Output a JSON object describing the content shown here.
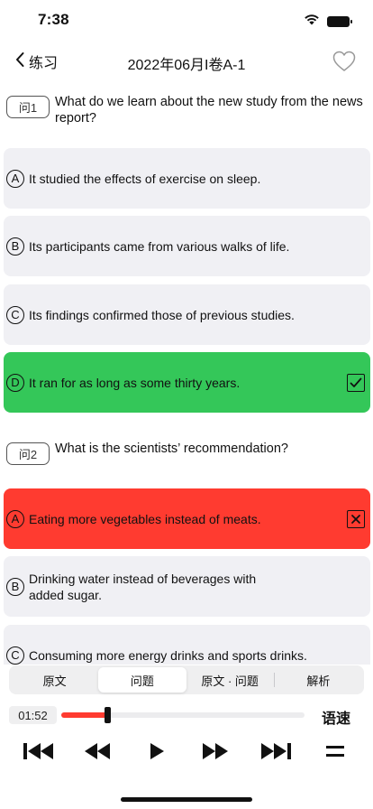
{
  "status": {
    "time": "7:38"
  },
  "nav": {
    "back_label": "练习",
    "title": "2022年06月I卷A-1"
  },
  "questions": [
    {
      "badge": "问1",
      "text": "What do we learn about the new study from the news report?",
      "options": [
        {
          "letter": "A",
          "text": "It studied the effects of exercise on sleep.",
          "state": "normal"
        },
        {
          "letter": "B",
          "text": "Its participants came from various walks of life.",
          "state": "normal"
        },
        {
          "letter": "C",
          "text": "Its findings confirmed those of previous studies.",
          "state": "normal"
        },
        {
          "letter": "D",
          "text": "It ran for as long as some thirty years.",
          "state": "correct"
        }
      ]
    },
    {
      "badge": "问2",
      "text": "What is the scientists’ recommendation?",
      "options": [
        {
          "letter": "A",
          "text": "Eating more vegetables instead of meats.",
          "state": "wrong"
        },
        {
          "letter": "B",
          "text": "Drinking water instead of beverages with added sugar.",
          "state": "normal"
        },
        {
          "letter": "C",
          "text": "Consuming more energy drinks and sports drinks.",
          "state": "normal"
        }
      ]
    }
  ],
  "tabs": [
    {
      "label": "原文",
      "active": false
    },
    {
      "label": "问题",
      "active": true
    },
    {
      "label": "原文 · 问题",
      "active": false
    },
    {
      "label": "解析",
      "active": false
    }
  ],
  "player": {
    "current_time": "01:52",
    "progress": 0.19,
    "speed_label": "语速"
  },
  "colors": {
    "correct": "#34c759",
    "wrong": "#ff3b30",
    "option_bg": "#f0f0f4",
    "progress": "#ff3b30"
  }
}
